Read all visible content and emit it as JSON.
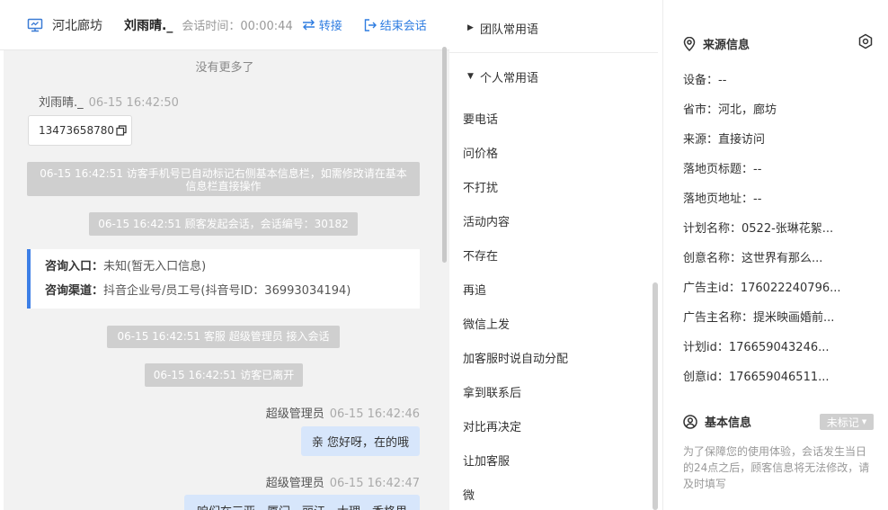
{
  "header": {
    "location": "河北廊坊",
    "visitor_name": "刘雨晴._",
    "duration": "会话时间：00:00:44",
    "transfer_label": "转接",
    "end_label": "结束会话"
  },
  "chat": {
    "no_more": "没有更多了",
    "visitor_msg": {
      "sender": "刘雨晴._",
      "time": "06-15 16:42:50",
      "text": "13473658780"
    },
    "system_msgs": [
      "06-15 16:42:51 访客手机号已自动标记右侧基本信息栏，如需修改请在基本信息栏直接操作",
      "06-15 16:42:51 顾客发起会话，会话编号：30182",
      "06-15 16:42:51 客服 超级管理员 接入会话",
      "06-15 16:42:51 访客已离开"
    ],
    "entry_card": {
      "entry_label": "咨询入口：",
      "entry_value": "未知(暂无入口信息)",
      "channel_label": "咨询渠道：",
      "channel_value": "抖音企业号/员工号(抖音号ID：36993034194)"
    },
    "agent_msgs": [
      {
        "sender": "超级管理员",
        "time": "06-15 16:42:46",
        "text": "亲 您好呀，在的哦"
      },
      {
        "sender": "超级管理员",
        "time": "06-15 16:42:47",
        "text": "咱们在三亚、厦门、丽江、大理、香格里"
      }
    ]
  },
  "phrases": {
    "team_group": "团队常用语",
    "personal_group": "个人常用语",
    "items": [
      "要电话",
      "问价格",
      "不打扰",
      "活动内容",
      "不存在",
      "再追",
      "微信上发",
      "加客服时说自动分配",
      "拿到联系后",
      "对比再决定",
      "让加客服",
      "微"
    ]
  },
  "info": {
    "source_title": "来源信息",
    "rows": [
      "设备：--",
      "省市：河北，廊坊",
      "来源：直接访问",
      "落地页标题：--",
      "落地页地址：--",
      "计划名称：0522-张琳花絮...",
      "创意名称：这世界有那么...",
      "广告主id：176022240796...",
      "广告主名称：提米映画婚前...",
      "计划id：176659043246...",
      "创意id：176659046511..."
    ],
    "basic_title": "基本信息",
    "tag_label": "未标记",
    "note": "为了保障您的使用体验，会话发生当日的24点之后，顾客信息将无法修改，请及时填写"
  }
}
